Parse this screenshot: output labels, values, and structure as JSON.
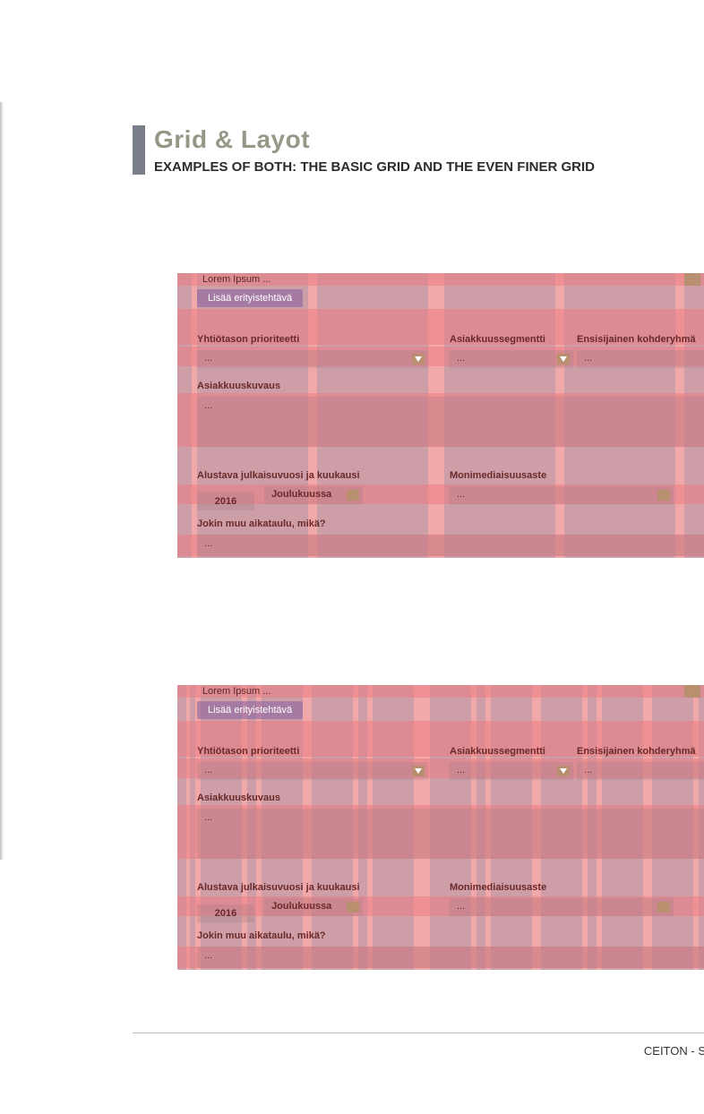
{
  "title": "Grid & Layot",
  "subtitle": "EXAMPLES OF BOTH: THE BASIC GRID AND THE EVEN FINER GRID",
  "example": {
    "lorem": "Lorem Ipsum ...",
    "add_button": "Lisää erityistehtävä",
    "field_priority": "Yhtiötason prioriteetti",
    "field_segment": "Asiakkuussegmentti",
    "field_target": "Ensisijainen kohderyhmä",
    "field_description": "Asiakkuuskuvaus",
    "field_release": "Alustava julkaisuvuosi ja kuukausi",
    "field_multimedia": "Monimediaisuusaste",
    "field_schedule": "Jokin muu aikataulu, mikä?",
    "placeholder": "...",
    "year": "2016",
    "month": "Joulukuussa"
  },
  "footer": "CEITON - S"
}
